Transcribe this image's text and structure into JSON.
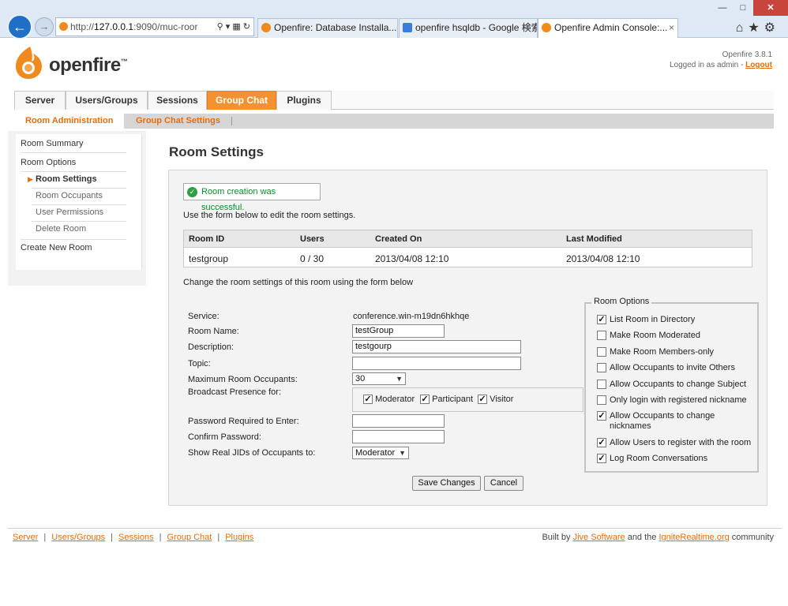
{
  "browser": {
    "address_host": "127.0.0.1",
    "address_rest": ":9090/muc-roor",
    "address_scheme": "http://",
    "tabs": [
      {
        "label": "Openfire: Database Installa..."
      },
      {
        "label": "openfire hsqldb - Google 検索"
      },
      {
        "label": "Openfire Admin Console:..."
      }
    ],
    "tab_close": "×"
  },
  "header": {
    "logo_text": "openfire",
    "logo_tm": "™",
    "version": "Openfire 3.8.1",
    "logged_in_text": "Logged in as admin - ",
    "logout_label": "Logout"
  },
  "main_tabs": [
    {
      "label": "Server"
    },
    {
      "label": "Users/Groups"
    },
    {
      "label": "Sessions"
    },
    {
      "label": "Group Chat"
    },
    {
      "label": "Plugins"
    }
  ],
  "sub_tabs": [
    {
      "label": "Room Administration"
    },
    {
      "label": "Group Chat Settings"
    }
  ],
  "sidebar": {
    "items": [
      {
        "label": "Room Summary"
      },
      {
        "label": "Room Options"
      },
      {
        "label": "Room Settings"
      },
      {
        "label": "Room Occupants"
      },
      {
        "label": "User Permissions"
      },
      {
        "label": "Delete Room"
      },
      {
        "label": "Create New Room"
      }
    ]
  },
  "content": {
    "title": "Room Settings",
    "success_message": "Room creation was successful.",
    "intro": "Use the form below to edit the room settings.",
    "table": {
      "headers": [
        "Room ID",
        "Users",
        "Created On",
        "Last Modified"
      ],
      "row": [
        "testgroup",
        "0 / 30",
        "2013/04/08 12:10",
        "2013/04/08 12:10"
      ]
    },
    "change_text": "Change the room settings of this room using the form below",
    "form": {
      "service_label": "Service:",
      "service_value": "conference.win-m19dn6hkhqe",
      "room_name_label": "Room Name:",
      "room_name_value": "testGroup",
      "description_label": "Description:",
      "description_value": "testgourp",
      "topic_label": "Topic:",
      "topic_value": "",
      "max_occupants_label": "Maximum Room Occupants:",
      "max_occupants_value": "30",
      "broadcast_label": "Broadcast Presence for:",
      "broadcast_options": [
        {
          "label": "Moderator",
          "checked": true
        },
        {
          "label": "Participant",
          "checked": true
        },
        {
          "label": "Visitor",
          "checked": true
        }
      ],
      "password_label": "Password Required to Enter:",
      "confirm_label": "Confirm Password:",
      "real_jids_label": "Show Real JIDs of Occupants to:",
      "real_jids_value": "Moderator"
    },
    "room_options": {
      "legend": "Room Options",
      "items": [
        {
          "label": "List Room in Directory",
          "checked": true
        },
        {
          "label": "Make Room Moderated",
          "checked": false
        },
        {
          "label": "Make Room Members-only",
          "checked": false
        },
        {
          "label": "Allow Occupants to invite Others",
          "checked": false
        },
        {
          "label": "Allow Occupants to change Subject",
          "checked": false
        },
        {
          "label": "Only login with registered nickname",
          "checked": false
        },
        {
          "label": "Allow Occupants to change nicknames",
          "checked": true
        },
        {
          "label": "Allow Users to register with the room",
          "checked": true
        },
        {
          "label": "Log Room Conversations",
          "checked": true
        }
      ]
    },
    "save_label": "Save Changes",
    "cancel_label": "Cancel"
  },
  "footer": {
    "links": [
      {
        "label": "Server"
      },
      {
        "label": "Users/Groups"
      },
      {
        "label": "Sessions"
      },
      {
        "label": "Group Chat"
      },
      {
        "label": "Plugins"
      }
    ],
    "separator": "|",
    "built_by": "Built by ",
    "jive": "Jive Software",
    "and_the": " and the ",
    "ignite": "IgniteRealtime.org",
    "community": " community"
  },
  "colors": {
    "accent": "#e46d0e",
    "active_tab": "#f49131",
    "success": "#0d8a2c"
  }
}
